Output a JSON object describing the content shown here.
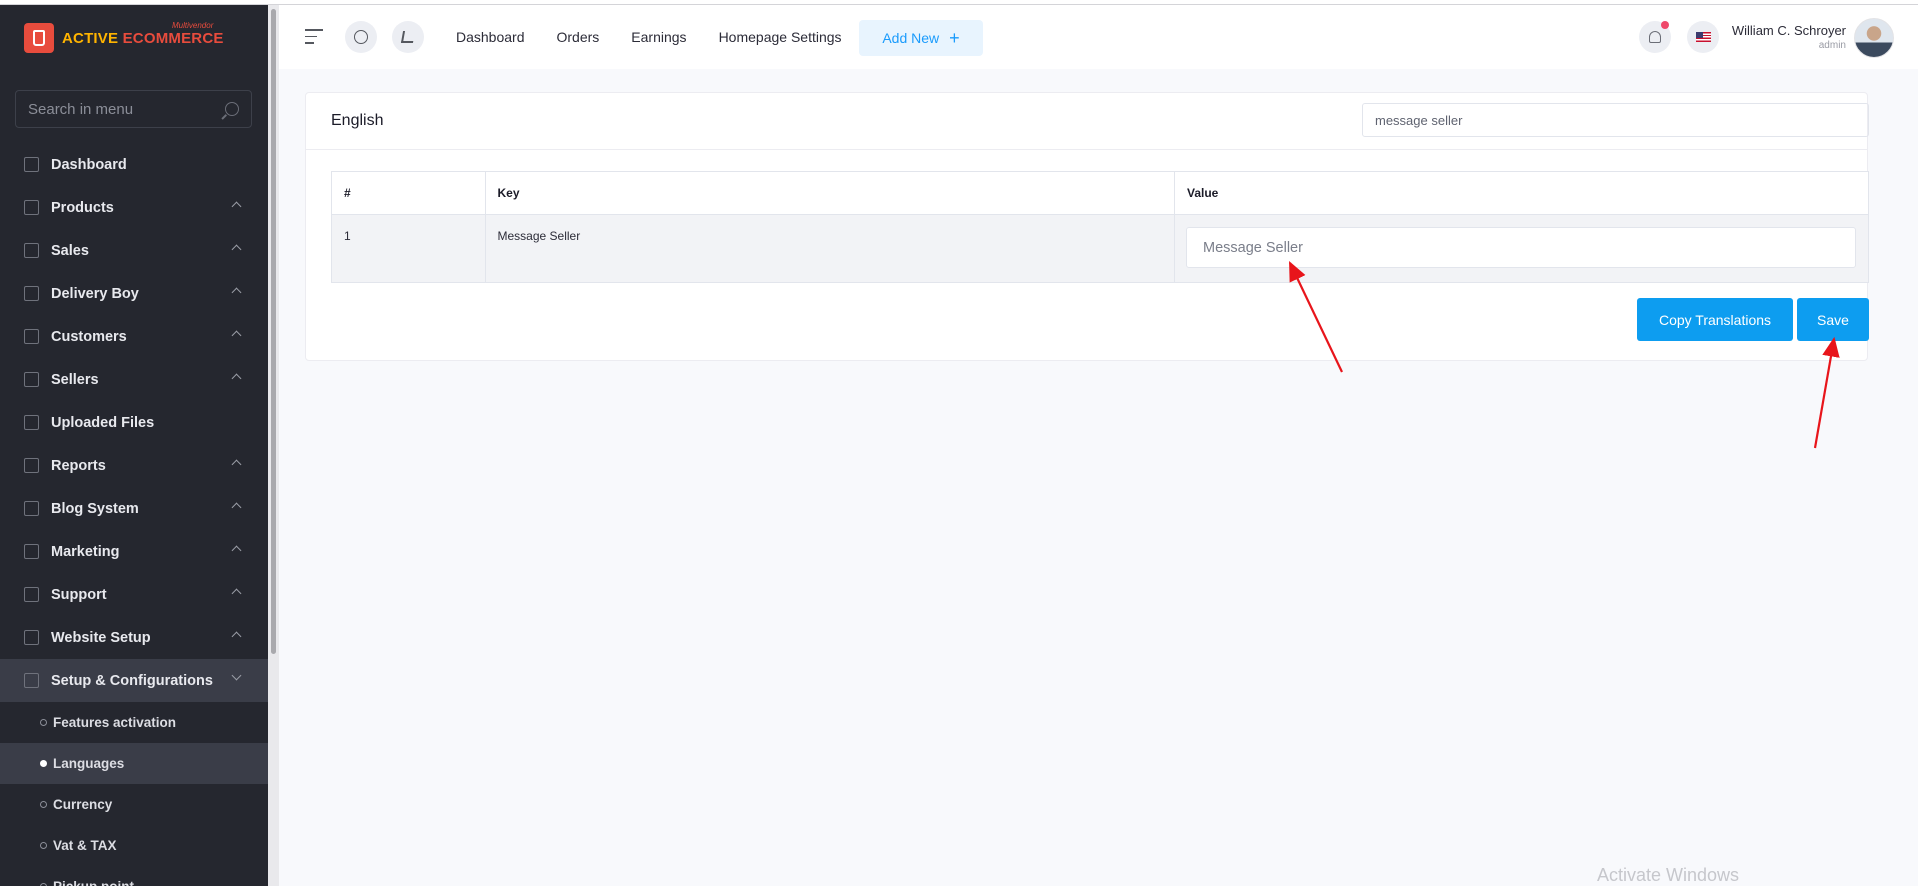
{
  "brand": {
    "name_part1": "ACTIVE",
    "name_part2": "ECOMMERCE",
    "tagline": "Multivendor"
  },
  "sidebar": {
    "search_placeholder": "Search in menu",
    "items": [
      {
        "label": "Dashboard",
        "expandable": false
      },
      {
        "label": "Products",
        "expandable": true
      },
      {
        "label": "Sales",
        "expandable": true
      },
      {
        "label": "Delivery Boy",
        "expandable": true
      },
      {
        "label": "Customers",
        "expandable": true
      },
      {
        "label": "Sellers",
        "expandable": true
      },
      {
        "label": "Uploaded Files",
        "expandable": false
      },
      {
        "label": "Reports",
        "expandable": true
      },
      {
        "label": "Blog System",
        "expandable": true
      },
      {
        "label": "Marketing",
        "expandable": true
      },
      {
        "label": "Support",
        "expandable": true
      },
      {
        "label": "Website Setup",
        "expandable": true
      },
      {
        "label": "Setup & Configurations",
        "expandable": true,
        "expanded": true
      }
    ],
    "subitems": [
      {
        "label": "Features activation",
        "active": false
      },
      {
        "label": "Languages",
        "active": true
      },
      {
        "label": "Currency",
        "active": false
      },
      {
        "label": "Vat & TAX",
        "active": false
      },
      {
        "label": "Pickup point",
        "active": false
      }
    ]
  },
  "header": {
    "nav": [
      "Dashboard",
      "Orders",
      "Earnings",
      "Homepage Settings"
    ],
    "add_new": "Add New",
    "user_name": "William C. Schroyer",
    "user_role": "admin"
  },
  "card": {
    "title": "English",
    "search_value": "message seller",
    "columns": [
      "#",
      "Key",
      "Value"
    ],
    "rows": [
      {
        "index": "1",
        "key": "Message Seller",
        "value_placeholder": "Message Seller"
      }
    ],
    "copy_button": "Copy Translations",
    "save_button": "Save"
  },
  "watermark": "Activate Windows",
  "colors": {
    "sidebar": "#25272f",
    "accent": "#0d9df0",
    "brand_red": "#e84c3d",
    "brand_yellow": "#ffb400",
    "annotation_arrow": "#e8151b"
  }
}
